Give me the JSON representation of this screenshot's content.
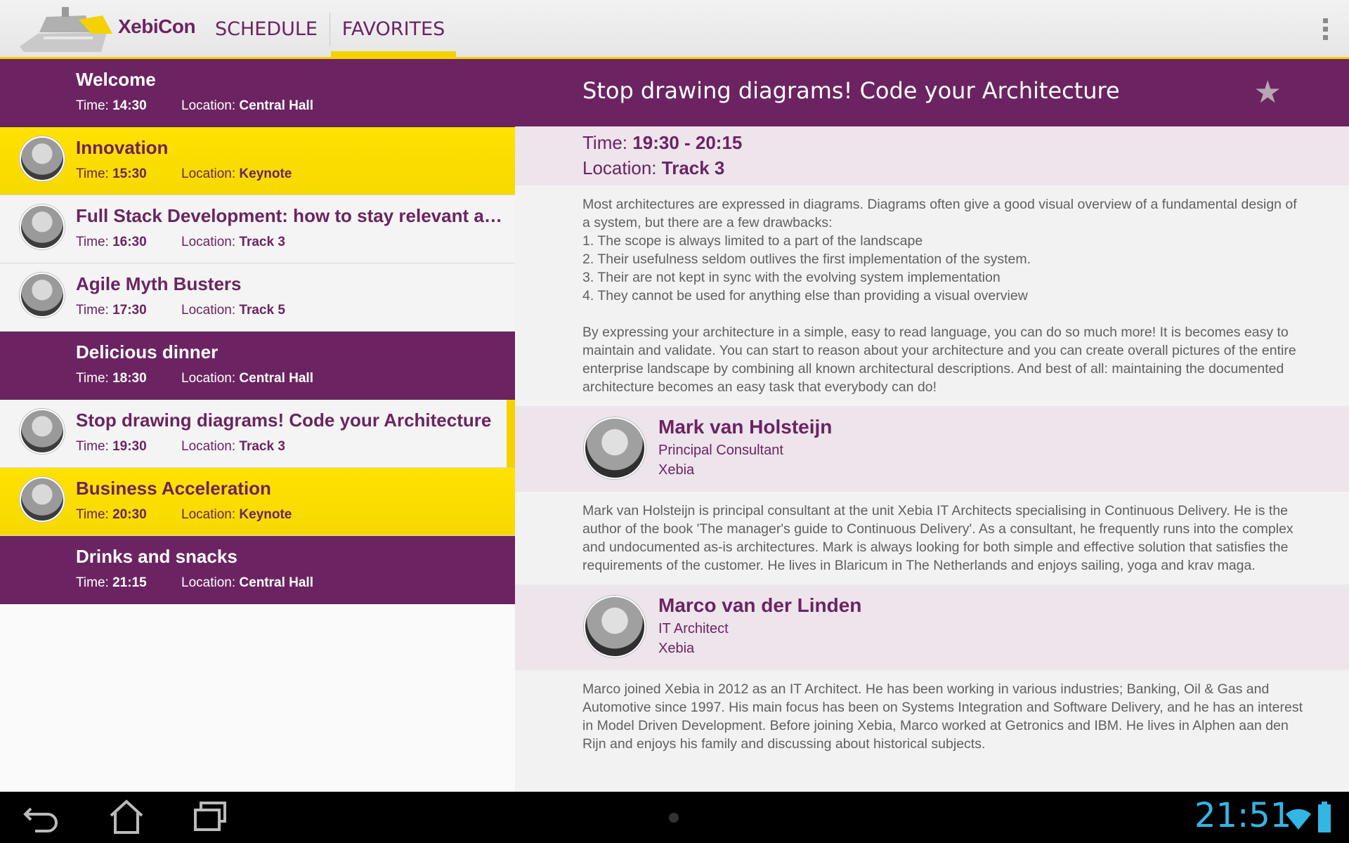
{
  "app": {
    "title": "XebiCon"
  },
  "tabs": [
    {
      "label": "SCHEDULE"
    },
    {
      "label": "FAVORITES"
    }
  ],
  "colors": {
    "primary": "#6b2461",
    "accent": "#f3d200",
    "clock": "#33b5e5"
  },
  "sessions": [
    {
      "title": "Welcome",
      "time_label": "Time:",
      "time": "14:30",
      "location_label": "Location:",
      "location": "Central Hall",
      "style": "purple"
    },
    {
      "title": "Innovation",
      "time_label": "Time:",
      "time": "15:30",
      "location_label": "Location:",
      "location": "Keynote",
      "style": "yellow"
    },
    {
      "title": "Full Stack Development: how to stay relevant as a…",
      "time_label": "Time:",
      "time": "16:30",
      "location_label": "Location:",
      "location": "Track 3",
      "style": "white"
    },
    {
      "title": "Agile Myth Busters",
      "time_label": "Time:",
      "time": "17:30",
      "location_label": "Location:",
      "location": "Track 5",
      "style": "white"
    },
    {
      "title": "Delicious dinner",
      "time_label": "Time:",
      "time": "18:30",
      "location_label": "Location:",
      "location": "Central Hall",
      "style": "purple"
    },
    {
      "title": "Stop drawing diagrams! Code your Architecture",
      "time_label": "Time:",
      "time": "19:30",
      "location_label": "Location:",
      "location": "Track 3",
      "style": "selected"
    },
    {
      "title": "Business Acceleration",
      "time_label": "Time:",
      "time": "20:30",
      "location_label": "Location:",
      "location": "Keynote",
      "style": "yellow"
    },
    {
      "title": "Drinks and snacks",
      "time_label": "Time:",
      "time": "21:15",
      "location_label": "Location:",
      "location": "Central Hall",
      "style": "purple"
    }
  ],
  "detail": {
    "title": "Stop drawing diagrams! Code your Architecture",
    "time_label": "Time:",
    "time": "19:30 - 20:15",
    "location_label": "Location:",
    "location": "Track 3",
    "description_lines": [
      "Most architectures are expressed in diagrams. Diagrams often give a good visual overview of a fundamental design of a system, but there are a few drawbacks:",
      "1. The scope is always limited to a part of the landscape",
      "2. Their usefulness seldom outlives the first implementation of the system.",
      "3. Their are not kept in sync with the evolving system implementation",
      "4. They cannot be used for anything else than providing a visual overview"
    ],
    "description_para2": "By expressing your architecture in a simple, easy to read language, you can do so much more! It is becomes easy to maintain and validate. You can start to reason about your architecture and you can create overall pictures of the entire enterprise landscape by combining all known architectural descriptions. And best of all: maintaining the documented architecture becomes an easy task that everybody can do!",
    "speakers": [
      {
        "name": "Mark van Holsteijn",
        "role": "Principal Consultant",
        "company": "Xebia",
        "bio": "Mark van Holsteijn is principal consultant at the unit Xebia IT Architects specialising in Continuous Delivery. He is the author of the book 'The manager's guide to Continuous Delivery'. As a consultant, he frequently runs into the complex and undocumented as-is architectures. Mark is always looking for both simple and effective solution that satisfies the requirements of the customer. He lives in Blaricum in The Netherlands and enjoys sailing, yoga and krav maga."
      },
      {
        "name": "Marco van der Linden",
        "role": "IT Architect",
        "company": "Xebia",
        "bio": "Marco joined Xebia in 2012 as an IT Architect. He has been working in various industries; Banking, Oil & Gas and Automotive since 1997. His main focus has been on Systems Integration and Software Delivery, and he has an interest in Model Driven Development. Before joining Xebia, Marco worked at Getronics and IBM. He lives in Alphen aan den Rijn and enjoys his family and discussing about historical subjects."
      }
    ]
  },
  "statusbar": {
    "clock": "21:51"
  },
  "icons": {
    "star": "star-icon",
    "overflow": "overflow-menu-icon",
    "back": "back-icon",
    "home": "home-icon",
    "recent": "recent-apps-icon",
    "wifi": "wifi-icon",
    "battery": "battery-icon"
  }
}
